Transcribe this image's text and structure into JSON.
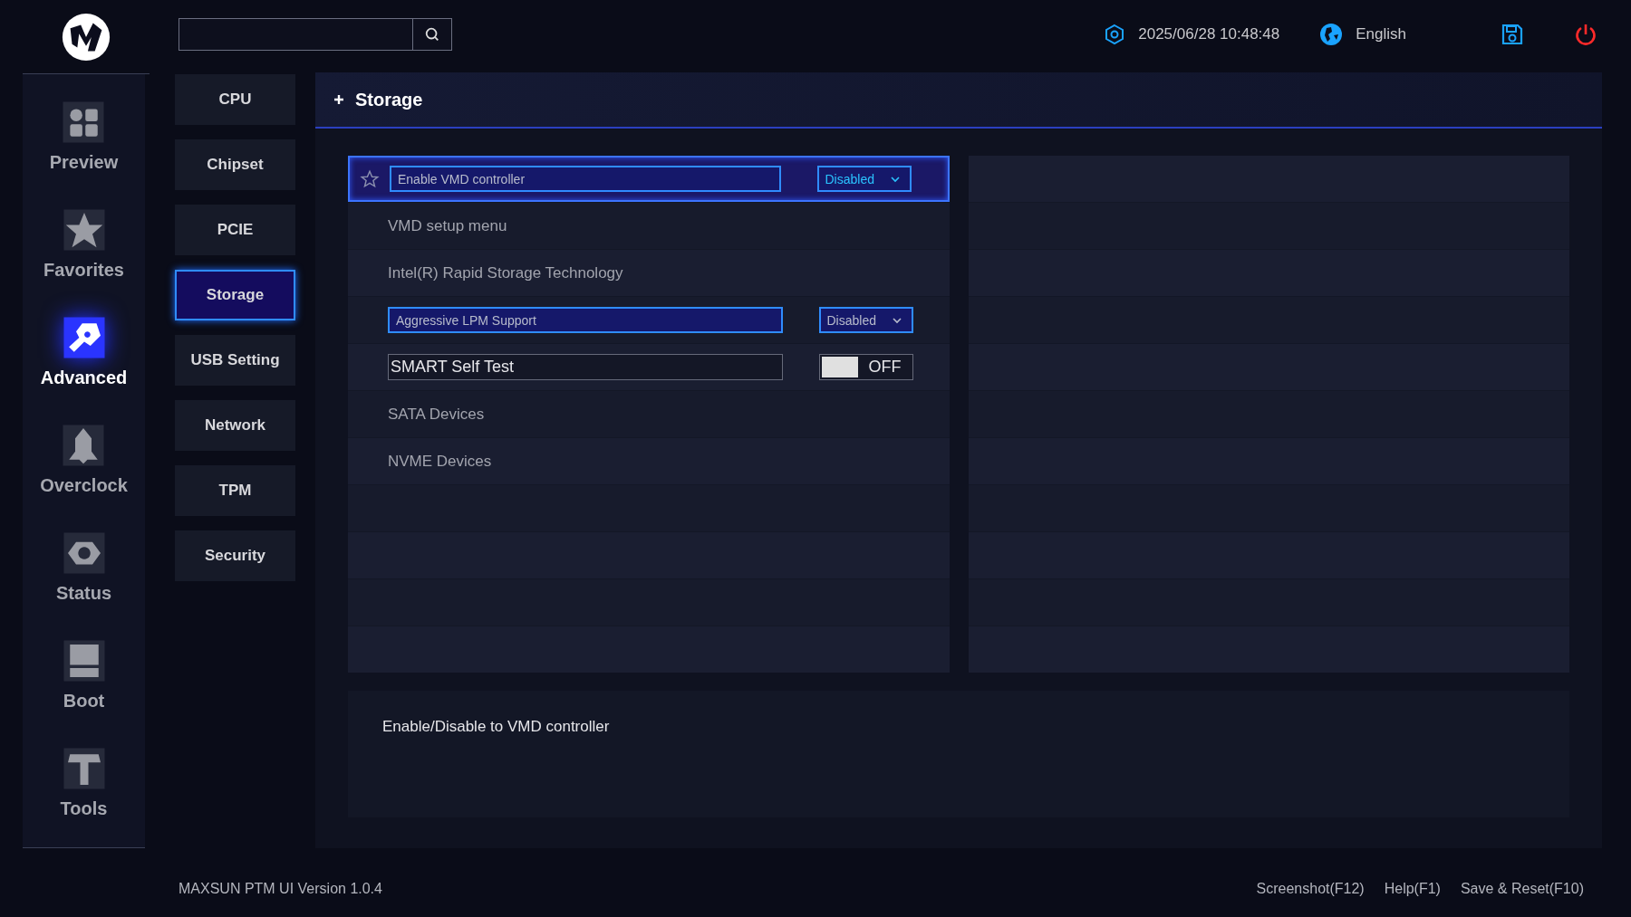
{
  "top_bar": {
    "datetime": "2025/06/28 10:48:48",
    "language": "English"
  },
  "nav": [
    {
      "label": "Preview",
      "selected": false
    },
    {
      "label": "Favorites",
      "selected": false
    },
    {
      "label": "Advanced",
      "selected": true
    },
    {
      "label": "Overclock",
      "selected": false
    },
    {
      "label": "Status",
      "selected": false
    },
    {
      "label": "Boot",
      "selected": false
    },
    {
      "label": "Tools",
      "selected": false
    }
  ],
  "submenu": [
    {
      "label": "CPU",
      "selected": false
    },
    {
      "label": "Chipset",
      "selected": false
    },
    {
      "label": "PCIE",
      "selected": false
    },
    {
      "label": "Storage",
      "selected": true
    },
    {
      "label": "USB Setting",
      "selected": false
    },
    {
      "label": "Network",
      "selected": false
    },
    {
      "label": "TPM",
      "selected": false
    },
    {
      "label": "Security",
      "selected": false
    }
  ],
  "panel": {
    "title": "Storage",
    "settings": [
      {
        "kind": "dropdown",
        "label": "Enable VMD controller",
        "value": "Disabled",
        "selected": true
      },
      {
        "kind": "link",
        "label": "VMD setup menu",
        "selected": false
      },
      {
        "kind": "link",
        "label": "Intel(R) Rapid Storage Technology",
        "selected": false
      },
      {
        "kind": "dropdown",
        "label": "Aggressive LPM Support",
        "value": "Disabled",
        "selected": false
      },
      {
        "kind": "toggle",
        "label": "SMART Self Test",
        "on": false,
        "value": "OFF",
        "selected": false
      },
      {
        "kind": "link",
        "label": "SATA Devices",
        "selected": false
      },
      {
        "kind": "link",
        "label": "NVME Devices",
        "selected": false
      }
    ],
    "help": "Enable/Disable to VMD controller"
  },
  "status_bar": {
    "version": "MAXSUN PTM UI Version 1.0.4",
    "actions": [
      "Screenshot(F12)",
      "Help(F1)",
      "Save & Reset(F10)"
    ]
  }
}
